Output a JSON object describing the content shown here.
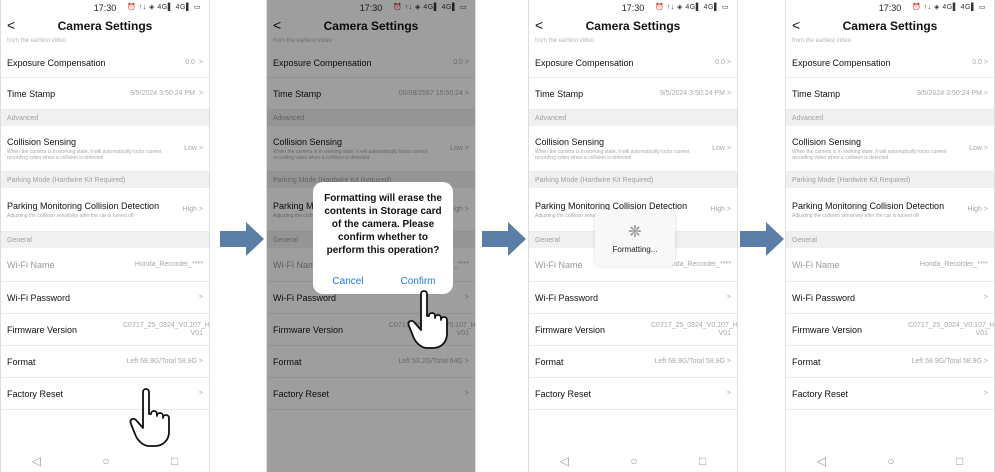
{
  "status": {
    "time": "17:30",
    "icons": "⏰ ↑↓ ◈ 4G▌ 4G▌ ▭"
  },
  "header": {
    "back": "<",
    "title": "Camera Settings"
  },
  "subnote": "from the earliest video",
  "settings": {
    "exposure_label": "Exposure Compensation",
    "exposure_value": "0.0",
    "timestamp_label": "Time Stamp",
    "advanced": "Advanced",
    "collision_label": "Collision Sensing",
    "collision_desc": "When the camera is in working state, it will automatically locks current recording video when a collision is detected",
    "collision_value": "Low",
    "parking_section": "Parking Mode (Hardwire Kit Required)",
    "parking_section_short": "Parking Mode (H",
    "parking_section_tail": ")",
    "parking_label": "Parking Monitoring Collision Detection",
    "parking_label_short": "Parking Monitor",
    "parking_label_tail": "tion",
    "parking_label_p2": "Parki",
    "parking_label_p2_tail": "",
    "parking_desc": "Adjusting the collision sensitivity after the car is turned off",
    "parking_desc_p3_a": "Adjusting the collisi",
    "parking_desc_p3_b": "r is",
    "parking_desc_p3_c": "turned off",
    "parking_value": "High",
    "general": "General",
    "wifi_name_label": "Wi-Fi Name",
    "wifi_name_value": "Honda_Recorder_****",
    "wifi_pwd_label": "Wi-Fi Password",
    "firmware_label": "Firmware Version",
    "firmware_value": "C0717_25_0324_V0.107_HW V01",
    "format_label": "Format",
    "factory_label": "Factory Reset",
    "chev": ">"
  },
  "screens": [
    {
      "timestamp_value": "9/5/2024 3:50:24 PM",
      "format_value": "Left 58.9G/Total 58.9G"
    },
    {
      "timestamp_value": "05/09/2567 15:50:24",
      "format_value": "Left 53.2G/Total 64G"
    },
    {
      "timestamp_value": "9/5/2024 3:50:24 PM",
      "format_value": "Left 58.9G/Total 58.9G"
    },
    {
      "timestamp_value": "9/5/2024 3:50:24 PM",
      "format_value": "Left 58.9G/Total 58.9G"
    }
  ],
  "dialog": {
    "message": "Formatting will erase the contents in Storage card of the camera. Please confirm whether to perform this operation?",
    "cancel": "Cancel",
    "confirm": "Confirm"
  },
  "spinner": {
    "text": "Formatting..."
  },
  "nav": {
    "back": "◁",
    "home": "○",
    "recent": "□"
  },
  "colors": {
    "arrow": "#5b7ea6",
    "accent": "#1e7be6"
  }
}
